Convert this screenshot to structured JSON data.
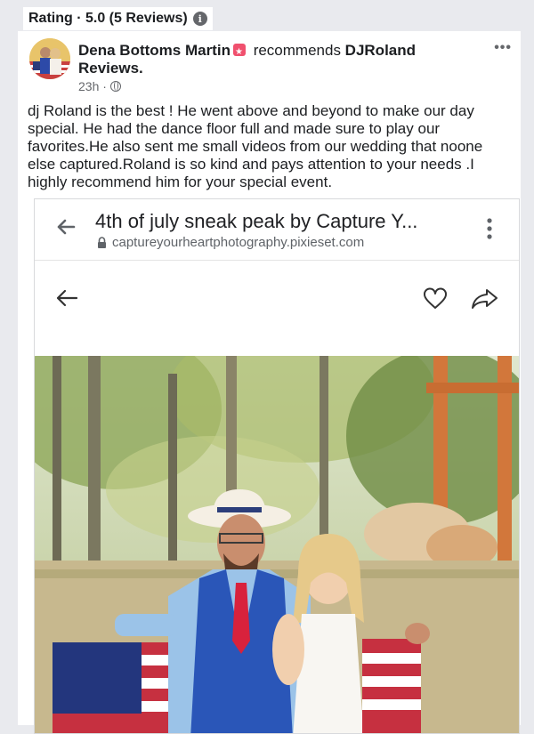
{
  "rating": {
    "label": "Rating · 5.0 (5 Reviews)",
    "info_icon": "i"
  },
  "post": {
    "author": "Dena Bottoms Martin",
    "verb": " recommends ",
    "target": "DJRoland Reviews.",
    "time": "23h ·",
    "menu": "•••",
    "text": "dj Roland is the best ! He went above and beyond  to make our day special. He had the dance floor full and made sure to play our favorites.He also sent me small videos  from our wedding that noone else  captured.Roland is so kind and pays attention  to your needs .I highly  recommend  him for your special  event."
  },
  "browser": {
    "title": "4th of july sneak peak by Capture Y...",
    "url": "captureyourheartphotography.pixieset.com"
  },
  "icons": {
    "info": "info-icon",
    "badge": "recommendation-badge-icon",
    "globe": "globe-icon",
    "more": "more-options-icon",
    "back": "back-arrow-icon",
    "lock": "lock-icon",
    "kebab": "kebab-menu-icon",
    "heart": "heart-icon",
    "share": "share-icon"
  },
  "colors": {
    "background": "#e9eaee",
    "text": "#1c1e21",
    "secondary": "#65676b",
    "badge": "#f0506e"
  }
}
